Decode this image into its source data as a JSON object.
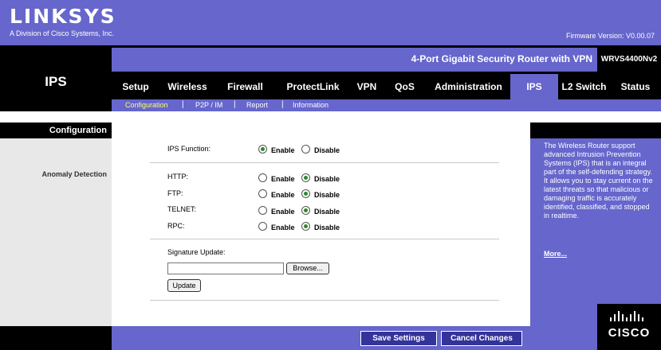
{
  "brand": {
    "logo": "LINKSYS",
    "registered": "®",
    "subtitle": "A Division of Cisco Systems, Inc.",
    "firmware": "Firmware Version: V0.00.07"
  },
  "product": {
    "name": "4-Port Gigabit Security Router with VPN",
    "model": "WRVS4400Nv2"
  },
  "page_title": "IPS",
  "tabs": [
    {
      "label": "Setup"
    },
    {
      "label": "Wireless"
    },
    {
      "label": "Firewall"
    },
    {
      "label": "ProtectLink"
    },
    {
      "label": "VPN"
    },
    {
      "label": "QoS"
    },
    {
      "label": "Administration"
    },
    {
      "label": "IPS",
      "active": true
    },
    {
      "label": "L2 Switch"
    },
    {
      "label": "Status"
    }
  ],
  "subtabs": [
    {
      "label": "Configuration",
      "active": true
    },
    {
      "label": "P2P / IM"
    },
    {
      "label": "Report"
    },
    {
      "label": "Information"
    }
  ],
  "left": {
    "configuration": "Configuration",
    "anomaly_detection": "Anomaly Detection"
  },
  "form": {
    "ips_function_label": "IPS Function:",
    "ips_function_value": "Enable",
    "enable_label": "Enable",
    "disable_label": "Disable",
    "protocols": [
      {
        "label": "HTTP:",
        "value": "Disable"
      },
      {
        "label": "FTP:",
        "value": "Disable"
      },
      {
        "label": "TELNET:",
        "value": "Disable"
      },
      {
        "label": "RPC:",
        "value": "Disable"
      }
    ],
    "signature_label": "Signature Update:",
    "signature_value": "",
    "browse_label": "Browse...",
    "update_label": "Update"
  },
  "help": {
    "text": "The Wireless Router support advanced Intrusion Prevention Systems (IPS) that is an integral part of the self-defending strategy. It allows you to stay current on the latest threats so that malicious or damaging traffic is accurately identified, classified, and stopped in realtime.",
    "more": "More..."
  },
  "footer": {
    "save": "Save Settings",
    "cancel": "Cancel Changes",
    "cisco": "CISCO"
  },
  "colors": {
    "accent": "#6666cc",
    "dark": "#000000",
    "active_subtab": "#ffff66",
    "footer_button": "#333399"
  }
}
